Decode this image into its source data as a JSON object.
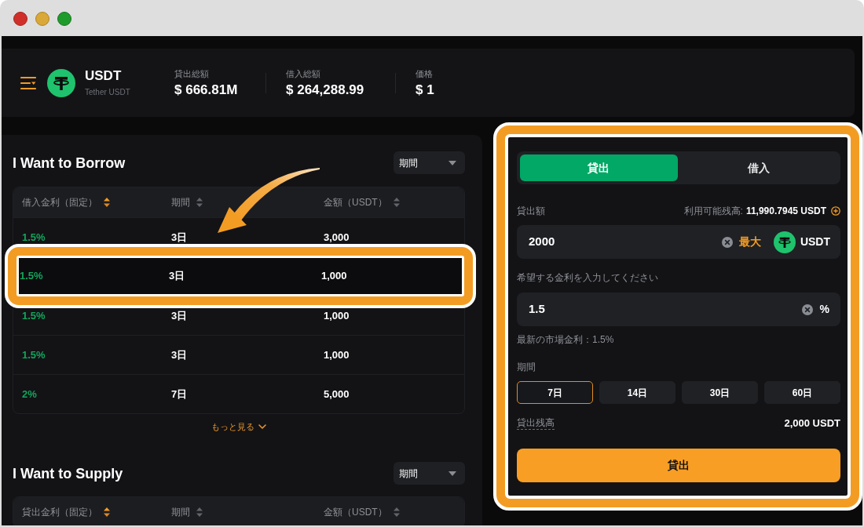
{
  "header": {
    "asset": {
      "symbol": "USDT",
      "name": "Tether USDT"
    },
    "stats": [
      {
        "label": "貸出総額",
        "value": "$ 666.81M"
      },
      {
        "label": "借入総額",
        "value": "$ 264,288.99"
      },
      {
        "label": "価格",
        "value": "$ 1"
      }
    ]
  },
  "sections": [
    {
      "title": "I Want to Borrow",
      "filter": {
        "label": "期間"
      },
      "columns": [
        {
          "label": "借入金利（固定）",
          "sorted": true
        },
        {
          "label": "期間",
          "sorted": false
        },
        {
          "label": "金額（USDT）",
          "sorted": false
        }
      ],
      "rows": [
        {
          "rate": "1.5%",
          "term": "3日",
          "amount": "3,000",
          "highlighted": false
        },
        {
          "rate": "1.5%",
          "term": "3日",
          "amount": "1,000",
          "highlighted": true
        },
        {
          "rate": "1.5%",
          "term": "3日",
          "amount": "1,000",
          "highlighted": false
        },
        {
          "rate": "1.5%",
          "term": "3日",
          "amount": "1,000",
          "highlighted": false
        },
        {
          "rate": "2%",
          "term": "7日",
          "amount": "5,000",
          "highlighted": false
        }
      ],
      "more_link": "もっと見る"
    },
    {
      "title": "I Want to Supply",
      "filter": {
        "label": "期間"
      },
      "columns": [
        {
          "label": "貸出金利（固定）",
          "sorted": true
        },
        {
          "label": "期間",
          "sorted": false
        },
        {
          "label": "金額（USDT）",
          "sorted": false
        }
      ]
    }
  ],
  "order_form": {
    "highlighted": true,
    "tabs": [
      {
        "label": "貸出",
        "selected": true
      },
      {
        "label": "借入",
        "selected": false
      }
    ],
    "amount": {
      "label": "貸出額",
      "available_label": "利用可能残高:",
      "available_value": "11,990.7945 USDT",
      "value": "2000",
      "max_label": "最大",
      "currency": "USDT"
    },
    "rate": {
      "label": "希望する金利を入力してください",
      "value": "1.5",
      "unit": "%"
    },
    "market_rate": "最新の市場金利：1.5%",
    "term": {
      "label": "期間",
      "options": [
        {
          "label": "7日",
          "selected": true
        },
        {
          "label": "14日",
          "selected": false
        },
        {
          "label": "30日",
          "selected": false
        },
        {
          "label": "60日",
          "selected": false
        }
      ]
    },
    "balance": {
      "label": "貸出残高",
      "value": "2,000 USDT"
    },
    "submit": "貸出"
  }
}
